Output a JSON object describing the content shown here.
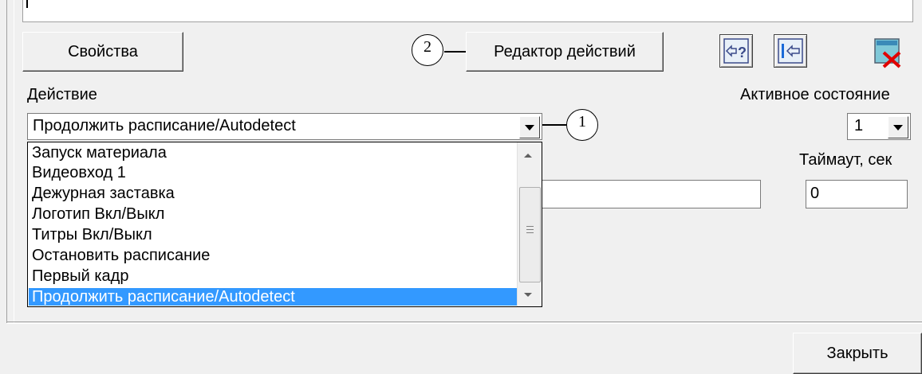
{
  "toolbar": {
    "properties_label": "Свойства",
    "action_editor_label": "Редактор действий",
    "icons": [
      "help-arrow-icon",
      "exit-arrow-icon",
      "delete-red-x-icon"
    ]
  },
  "action": {
    "label": "Действие",
    "selected": "Продолжить расписание/Autodetect",
    "options": [
      "Запуск материала",
      "Видеовход 1",
      "Дежурная заставка",
      "Логотип Вкл/Выкл",
      "Титры Вкл/Выкл",
      "Остановить расписание",
      "Первый кадр",
      "Продолжить расписание/Autodetect"
    ]
  },
  "active_state": {
    "label": "Активное состояние",
    "value": "1"
  },
  "timeout": {
    "label": "Таймаут, сек",
    "value": "0"
  },
  "callouts": {
    "one": "1",
    "two": "2"
  },
  "close_label": "Закрыть",
  "colors": {
    "selection": "#3399ff",
    "background": "#f0f0f0"
  }
}
